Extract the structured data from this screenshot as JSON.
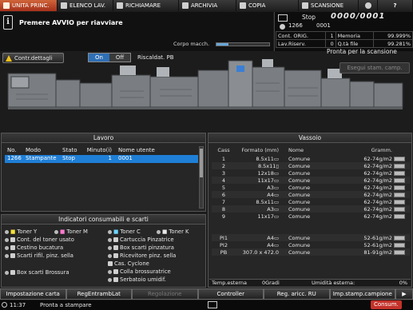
{
  "tabs": [
    {
      "label": "UNITA PRINC.",
      "active": true,
      "icon": "home-icon"
    },
    {
      "label": "ELENCO LAV.",
      "active": false,
      "icon": "job-list-icon"
    },
    {
      "label": "RICHIAMARE",
      "active": false,
      "icon": "recall-icon"
    },
    {
      "label": "ARCHIVIA",
      "active": false,
      "icon": "store-icon"
    },
    {
      "label": "COPIA",
      "active": false,
      "icon": "copy-icon"
    },
    {
      "label": "SCANSIONE",
      "active": false,
      "icon": "scan-icon"
    },
    {
      "label": "",
      "active": false,
      "icon": "settings-icon"
    },
    {
      "label": "?",
      "active": false,
      "icon": "help-icon"
    }
  ],
  "message": "Premere AVVIO per riavviare",
  "memory": {
    "label": "Corpo macch.",
    "fill_fraction": 0.22
  },
  "status": {
    "state": "Stop",
    "counter": "0000/0001",
    "job_no": "1266",
    "user": "0001",
    "cont_orig_label": "Cont. ORIG.",
    "cont_orig_value": "1",
    "memoria_label": "Memoria",
    "memoria_value": "99.999%",
    "lav_riserv_label": "Lav.Riserv.",
    "lav_riserv_value": "0",
    "qta_file_label": "Q.tà file",
    "qta_file_value": "99.281%"
  },
  "controls": {
    "warn_label": "Contr.dettagli",
    "on_label": "On",
    "off_label": "Off",
    "riscald_label": "Riscaldat. PB",
    "ready_label": "Pronta per la scansione",
    "exec_label": "Esegui stam. camp."
  },
  "job_panel": {
    "title": "Lavoro",
    "headers": {
      "no": "No.",
      "mode": "Modo",
      "state": "Stato",
      "minutes": "Minuto(i)",
      "user": "Nome utente"
    },
    "row": {
      "no": "1266",
      "mode": "Stampante",
      "state": "Stop",
      "minutes": "1",
      "user": "0001"
    }
  },
  "consumables": {
    "title": "Indicatori consumabili e scarti",
    "toner_y": "Toner Y",
    "toner_m": "Toner M",
    "toner_c": "Toner C",
    "toner_k": "Toner K",
    "cont_toner": "Cont. del toner usato",
    "cartuccia": "Cartuccia Pinzatrice",
    "cestino": "Cestino bucatura",
    "box_pinz": "Box scarti pinzatura",
    "scarti_rifil": "Scarti rifil. pinz. sella",
    "ricevitore": "Ricevitore pinz. sella",
    "cas_cyclone": "Cas. Cyclone",
    "box_brossura": "Box scarti Brossura",
    "colla": "Colla brossuratrice",
    "serbatoio": "Serbatoio umidif."
  },
  "tray_panel": {
    "title": "Vassoio",
    "headers": {
      "cass": "Cass",
      "format": "Formato (mm)",
      "name": "Nome",
      "gramm": "Gramm."
    },
    "rows": [
      {
        "cass": "1",
        "format": "8.5x11▭",
        "name": "Comune",
        "gramm": "62-74g/m2",
        "level": 0.9
      },
      {
        "cass": "2",
        "format": "8.5x11▯",
        "name": "Comune",
        "gramm": "62-74g/m2",
        "level": 0.9
      },
      {
        "cass": "3",
        "format": "12x18▭",
        "name": "Comune",
        "gramm": "62-74g/m2",
        "level": 0.9
      },
      {
        "cass": "4",
        "format": "11x17▭",
        "name": "Comune",
        "gramm": "62-74g/m2",
        "level": 0.9
      },
      {
        "cass": "5",
        "format": "A3▭",
        "name": "Comune",
        "gramm": "62-74g/m2",
        "level": 0.9
      },
      {
        "cass": "6",
        "format": "A4▭",
        "name": "Comune",
        "gramm": "62-74g/m2",
        "level": 0.9
      },
      {
        "cass": "7",
        "format": "8.5x11▭",
        "name": "Comune",
        "gramm": "62-74g/m2",
        "level": 0.9
      },
      {
        "cass": "8",
        "format": "A3▭",
        "name": "Comune",
        "gramm": "62-74g/m2",
        "level": 0.9
      },
      {
        "cass": "9",
        "format": "11x17▭",
        "name": "Comune",
        "gramm": "62-74g/m2",
        "level": 0.9
      },
      {
        "cass": "PI1",
        "format": "A4▭",
        "name": "Comune",
        "gramm": "52-61g/m2",
        "level": 0.9
      },
      {
        "cass": "PI2",
        "format": "A4▭",
        "name": "Comune",
        "gramm": "52-61g/m2",
        "level": 0.9
      },
      {
        "cass": "PB",
        "format": "307.0 x 472.0",
        "name": "Comune",
        "gramm": "81-91g/m2",
        "level": 0.9
      }
    ],
    "footer": {
      "temp_label": "Temp.esterna",
      "temp_value": "0Gradi",
      "hum_label": "Umidità esterna:",
      "hum_value": "0%"
    }
  },
  "bottom_buttons": [
    {
      "label": "Impostazione carta",
      "enabled": true
    },
    {
      "label": "RegEntrambLat",
      "enabled": true
    },
    {
      "label": "Regolazione",
      "enabled": false
    },
    {
      "label": "Controller",
      "enabled": true
    },
    {
      "label": "Reg. aricc. RU",
      "enabled": true
    },
    {
      "label": "Imp.stamp.campione",
      "enabled": true
    }
  ],
  "statusbar": {
    "time": "11:37",
    "ready": "Pronta a stampare",
    "consumables": "Consum."
  }
}
